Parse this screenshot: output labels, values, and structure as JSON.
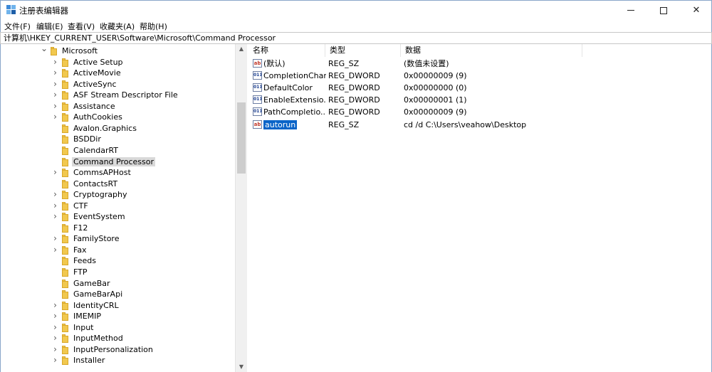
{
  "window": {
    "title": "注册表编辑器",
    "min_glyph": "",
    "close_glyph": "✕"
  },
  "menu": [
    {
      "label": "文件(F)"
    },
    {
      "label": "编辑(E)"
    },
    {
      "label": "查看(V)"
    },
    {
      "label": "收藏夹(A)"
    },
    {
      "label": "帮助(H)"
    }
  ],
  "address": "计算机\\HKEY_CURRENT_USER\\Software\\Microsoft\\Command Processor",
  "tree": {
    "parent": {
      "label": "Microsoft",
      "expanded": true
    },
    "items": [
      {
        "label": "Active Setup",
        "has_children": true
      },
      {
        "label": "ActiveMovie",
        "has_children": true
      },
      {
        "label": "ActiveSync",
        "has_children": true
      },
      {
        "label": "ASF Stream Descriptor File",
        "has_children": true
      },
      {
        "label": "Assistance",
        "has_children": true
      },
      {
        "label": "AuthCookies",
        "has_children": true
      },
      {
        "label": "Avalon.Graphics",
        "has_children": false
      },
      {
        "label": "BSDDir",
        "has_children": false
      },
      {
        "label": "CalendarRT",
        "has_children": false
      },
      {
        "label": "Command Processor",
        "has_children": false,
        "selected": true
      },
      {
        "label": "CommsAPHost",
        "has_children": true
      },
      {
        "label": "ContactsRT",
        "has_children": false
      },
      {
        "label": "Cryptography",
        "has_children": true
      },
      {
        "label": "CTF",
        "has_children": true
      },
      {
        "label": "EventSystem",
        "has_children": true
      },
      {
        "label": "F12",
        "has_children": false
      },
      {
        "label": "FamilyStore",
        "has_children": true
      },
      {
        "label": "Fax",
        "has_children": true
      },
      {
        "label": "Feeds",
        "has_children": false
      },
      {
        "label": "FTP",
        "has_children": false
      },
      {
        "label": "GameBar",
        "has_children": false
      },
      {
        "label": "GameBarApi",
        "has_children": false
      },
      {
        "label": "IdentityCRL",
        "has_children": true
      },
      {
        "label": "IMEMIP",
        "has_children": true
      },
      {
        "label": "Input",
        "has_children": true
      },
      {
        "label": "InputMethod",
        "has_children": true
      },
      {
        "label": "InputPersonalization",
        "has_children": true
      },
      {
        "label": "Installer",
        "has_children": true
      }
    ]
  },
  "columns": {
    "name": "名称",
    "type": "类型",
    "data": "数据"
  },
  "values": [
    {
      "name": "(默认)",
      "type": "REG_SZ",
      "data": "(数值未设置)",
      "icon": "string-value-icon"
    },
    {
      "name": "CompletionChar",
      "type": "REG_DWORD",
      "data": "0x00000009 (9)",
      "icon": "dword-value-icon"
    },
    {
      "name": "DefaultColor",
      "type": "REG_DWORD",
      "data": "0x00000000 (0)",
      "icon": "dword-value-icon"
    },
    {
      "name": "EnableExtensio...",
      "type": "REG_DWORD",
      "data": "0x00000001 (1)",
      "icon": "dword-value-icon"
    },
    {
      "name": "PathCompletio...",
      "type": "REG_DWORD",
      "data": "0x00000009 (9)",
      "icon": "dword-value-icon"
    },
    {
      "name": "autorun",
      "type": "REG_SZ",
      "data": "cd /d C:\\Users\\veahow\\Desktop",
      "icon": "string-value-icon",
      "selected": true
    }
  ]
}
